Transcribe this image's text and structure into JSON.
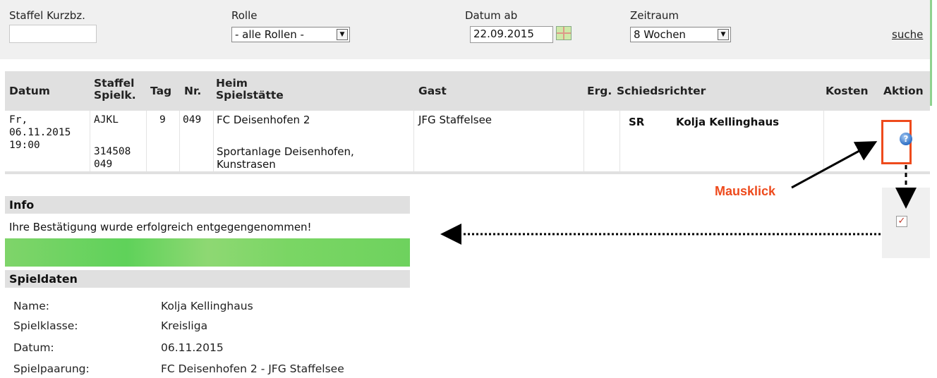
{
  "filters": {
    "staffel_label": "Staffel Kurzbz.",
    "staffel_value": "",
    "rolle_label": "Rolle",
    "rolle_value": "- alle Rollen -",
    "datum_label": "Datum ab",
    "datum_value": "22.09.2015",
    "zeitraum_label": "Zeitraum",
    "zeitraum_value": "8 Wochen",
    "search_link": "suche"
  },
  "table": {
    "headers": {
      "datum": "Datum",
      "staffel_1": "Staffel",
      "staffel_2": "Spielk.",
      "tag": "Tag",
      "nr": "Nr.",
      "heim_1": "Heim",
      "heim_2": "Spielstätte",
      "gast": "Gast",
      "erg": "Erg.",
      "schiedsrichter": "Schiedsrichter",
      "kosten": "Kosten",
      "aktion": "Aktion"
    },
    "rows": [
      {
        "date_line1": "Fr,",
        "date_line2": "06.11.2015",
        "date_line3": "19:00",
        "staffel": "AJKL",
        "spielk_1": "314508",
        "spielk_2": "049",
        "tag": "9",
        "nr": "049",
        "heim": "FC Deisenhofen 2",
        "venue_1": "Sportanlage Deisenhofen,",
        "venue_2": "Kunstrasen",
        "gast": "JFG Staffelsee",
        "erg": "",
        "role": "SR",
        "referee": "Kolja Kellinghaus",
        "kosten": ""
      }
    ]
  },
  "annotation": {
    "label": "Mausklick",
    "color": "#ee4a1c"
  },
  "info": {
    "title": "Info",
    "message": "Ihre Bestätigung wurde erfolgreich entgegengenommen!"
  },
  "spieldaten": {
    "title": "Spieldaten",
    "fields": [
      {
        "label": "Name:",
        "value": "Kolja Kellinghaus"
      },
      {
        "label": "Spielklasse:",
        "value": "Kreisliga"
      },
      {
        "label": "Datum:",
        "value": "06.11.2015"
      },
      {
        "label": "Spielpaarung:",
        "value": "FC Deisenhofen 2 - JFG Staffelsee"
      }
    ]
  },
  "icons": {
    "action": "help-icon",
    "calendar": "calendar-icon",
    "popup": "notepad-icon"
  }
}
